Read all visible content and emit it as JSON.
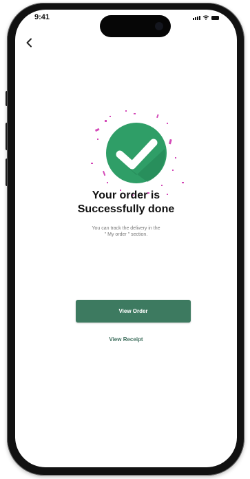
{
  "status_bar": {
    "time": "9:41"
  },
  "nav": {
    "back_icon": "chevron-left-icon"
  },
  "success": {
    "icon": "check-circle-icon",
    "title_line1": "Your order is",
    "title_line2": "Successfully done",
    "subtitle_line1": "You can track the delivery  in the",
    "subtitle_line2": "\" My order \" section."
  },
  "actions": {
    "primary_label": "View Order",
    "secondary_label": "View Receipt"
  },
  "colors": {
    "primary": "#3d7a60",
    "check_circle": "#2f9e67",
    "confetti": "#d44ab8",
    "link": "#3f6f5e"
  }
}
